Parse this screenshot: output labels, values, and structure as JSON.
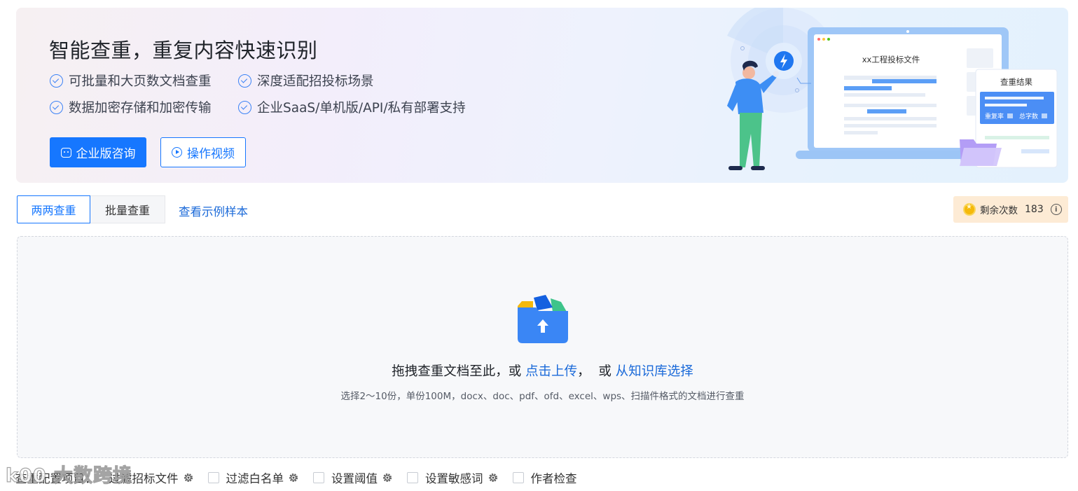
{
  "hero": {
    "title": "智能查重，重复内容快速识别",
    "features": [
      "可批量和大页数文档查重",
      "深度适配招投标场景",
      "数据加密存储和加密传输",
      "企业SaaS/单机版/API/私有部署支持"
    ],
    "consult_button": "企业版咨询",
    "video_button": "操作视频",
    "illustration": {
      "doc_title": "xx工程投标文件",
      "result_title": "查重结果",
      "result_left": "重复率",
      "result_right": "总字数"
    }
  },
  "tabs": [
    {
      "label": "两两查重",
      "active": true
    },
    {
      "label": "批量查重",
      "active": false
    }
  ],
  "sample_link": "查看示例样本",
  "remaining": {
    "label": "剩余次数",
    "count": "183"
  },
  "upload": {
    "prefix": "拖拽查重文档至此，或 ",
    "click_upload": "点击上传",
    "middle": "，  或 ",
    "from_kb": "从知识库选择",
    "hint": "选择2～10份，单份100M，docx、doc、pdf、ofd、excel、wps、扫描件格式的文档进行查重"
  },
  "config": {
    "label": "查重配置项目：",
    "options": [
      {
        "label": "过滤招标文件",
        "checked": false,
        "has_settings": true
      },
      {
        "label": "过滤白名单",
        "checked": false,
        "has_settings": true
      },
      {
        "label": "设置阈值",
        "checked": false,
        "has_settings": true
      },
      {
        "label": "设置敏感词",
        "checked": false,
        "has_settings": true
      },
      {
        "label": "作者检查",
        "checked": false,
        "has_settings": false
      }
    ]
  },
  "watermark": "k00 大数跨境",
  "colors": {
    "primary": "#1677ff",
    "link": "#1b6ad9",
    "remain_bg": "#fdebd5"
  }
}
